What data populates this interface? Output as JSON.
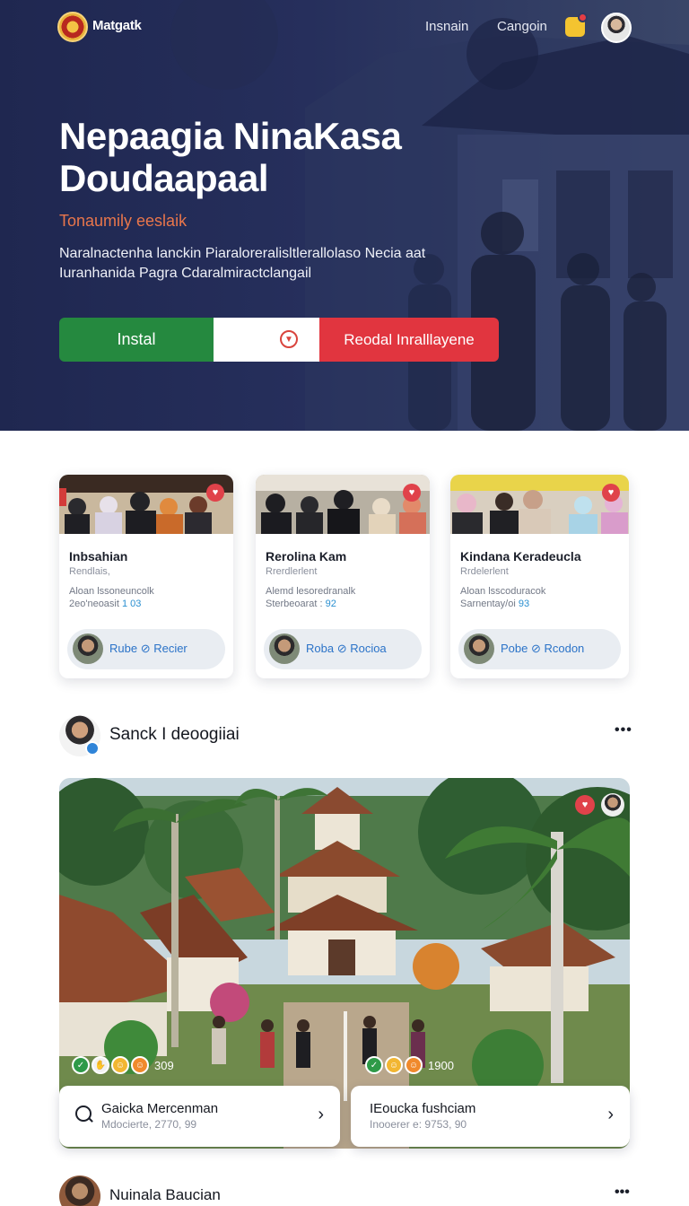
{
  "header": {
    "brand": "Matgatk",
    "nav": [
      "Insnain",
      "Cangoin"
    ],
    "icons": {
      "logo": "emblem-logo",
      "notification": "notification-icon",
      "avatar": "user-avatar"
    }
  },
  "hero": {
    "title": "Nepaagia NinaKasa Doudaapaal",
    "subtitle": "Tonaumily eeslaik",
    "description": "Naralnactenha lanckin Piaraloreralisltlerallolaso Necia aat Iuranhanida Pagra Cdaralmiractclangail",
    "buttons": {
      "install": "Instal",
      "secondary": "Reodal Inralllayene"
    },
    "colors": {
      "install": "#25893f",
      "secondary": "#e1353f",
      "subtitle": "#e9764b"
    }
  },
  "cards": [
    {
      "title": "Inbsahian",
      "meta": "Rendlais,",
      "line1": "Aloan lssoneuncolk",
      "line2_prefix": "2eo'neoasit ",
      "line2_value": "1 03",
      "pill": "Rube ⊘ Recier"
    },
    {
      "title": "Rerolina Kam",
      "meta": "Rrerdlerlent",
      "line1": "Alemd lesoredranalk",
      "line2_prefix": "Sterbeoarat : ",
      "line2_value": "92",
      "pill": "Roba ⊘ Rocioa"
    },
    {
      "title": "Kindana Keradeucla",
      "meta": "Rrdelerlent",
      "line1": "Aloan lsscoduracok",
      "line2_prefix": "Sarnentay/oi ",
      "line2_value": "93",
      "pill": "Pobe ⊘ Rcodon"
    }
  ],
  "post": {
    "author": "Sanck I deoogiiai",
    "more": "•••",
    "reactions": [
      {
        "count": "309"
      },
      {
        "count": "1900"
      }
    ],
    "locations": [
      {
        "title": "Gaicka Mercenman",
        "meta": "Mdocierte, 2770, 99"
      },
      {
        "title": "IEoucka fushciam",
        "meta": "Inooerer e: 9753, 90"
      }
    ]
  },
  "post2": {
    "author": "Nuinala Baucian",
    "more": "•••"
  }
}
